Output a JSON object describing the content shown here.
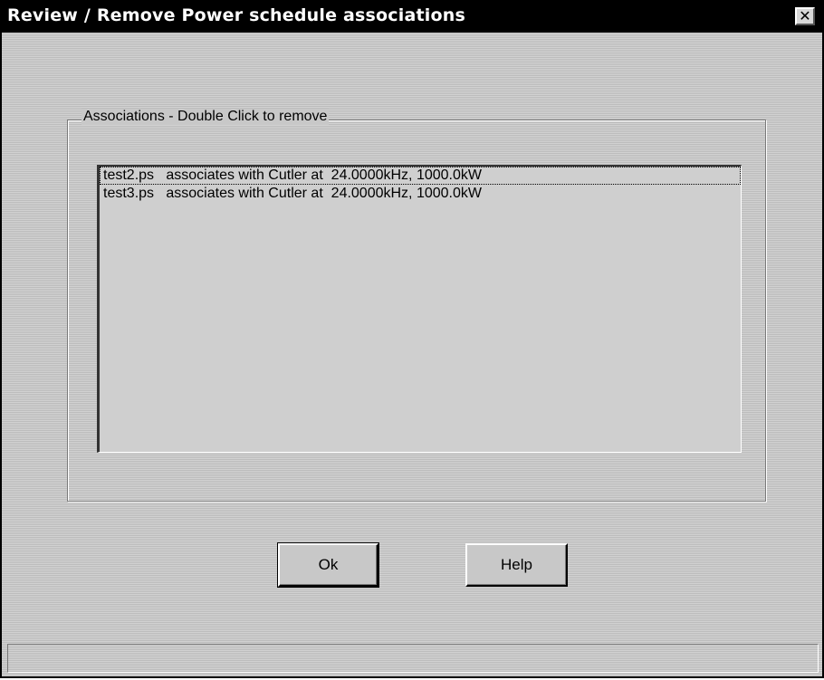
{
  "window": {
    "title": "Review / Remove Power schedule associations",
    "close_symbol": "✕"
  },
  "group": {
    "label": "Associations - Double Click to remove"
  },
  "associations": [
    {
      "text": "test2.ps   associates with Cutler at  24.0000kHz, 1000.0kW",
      "focused": true
    },
    {
      "text": "test3.ps   associates with Cutler at  24.0000kHz, 1000.0kW",
      "focused": false
    }
  ],
  "buttons": {
    "ok_label": "Ok",
    "help_label": "Help"
  },
  "status": {
    "text": ""
  }
}
